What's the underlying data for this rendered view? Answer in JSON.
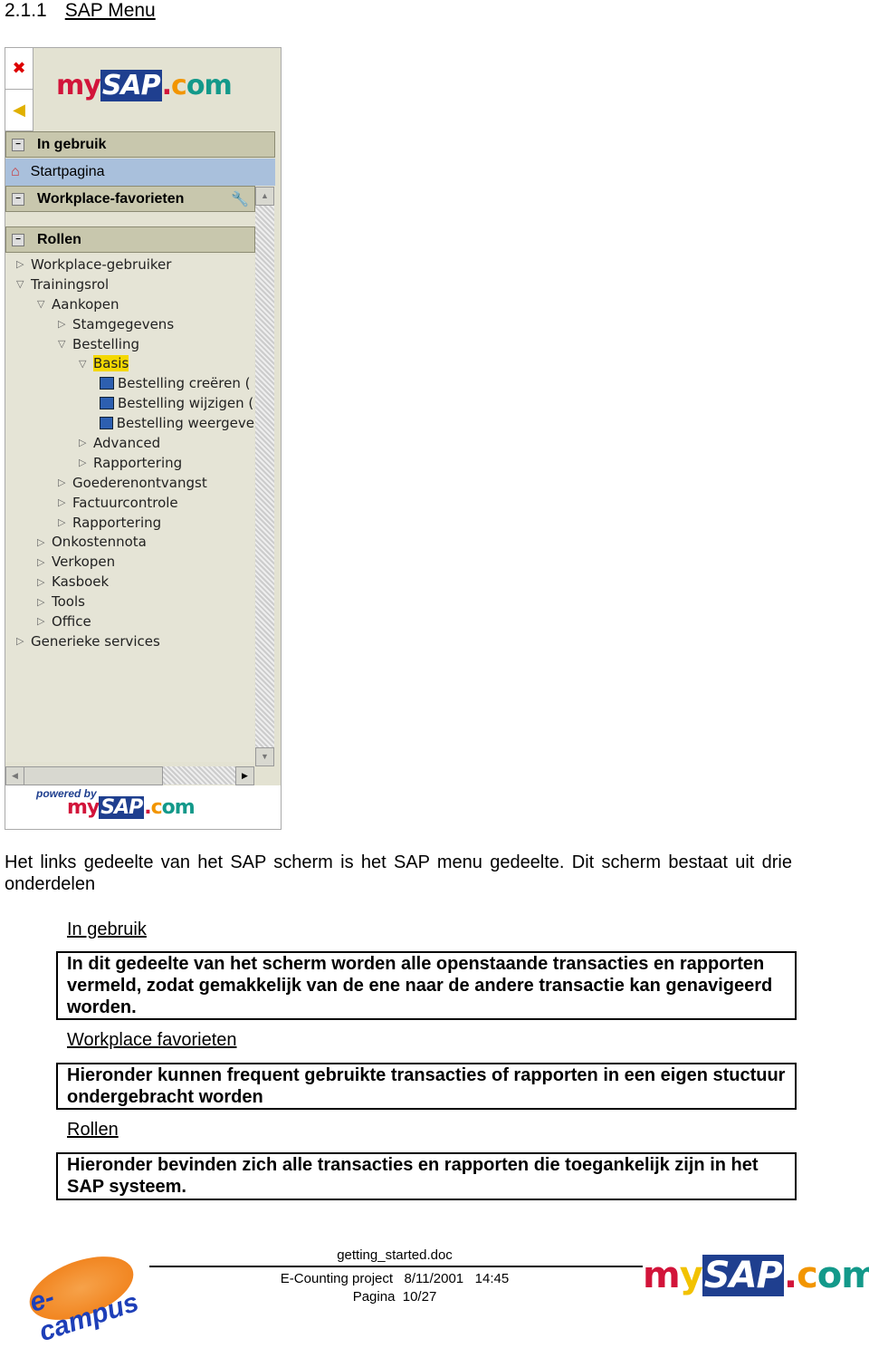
{
  "heading": {
    "number": "2.1.1",
    "title": "SAP Menu"
  },
  "panel": {
    "logo": {
      "my": "my",
      "sap": "SAP",
      "dot": ".",
      "com": "com"
    },
    "icons": {
      "close": "close-window-icon",
      "back": "back-arrow-icon"
    },
    "sections": {
      "in_use": "In gebruik",
      "favorites": "Workplace-favorieten",
      "roles": "Rollen"
    },
    "start_item": "Startpagina",
    "tree": [
      {
        "label": "Workplace-gebruiker",
        "level": 0,
        "type": "collapsed"
      },
      {
        "label": "Trainingsrol",
        "level": 0,
        "type": "expanded"
      },
      {
        "label": "Aankopen",
        "level": 1,
        "type": "expanded"
      },
      {
        "label": "Stamgegevens",
        "level": 2,
        "type": "collapsed"
      },
      {
        "label": "Bestelling",
        "level": 2,
        "type": "expanded"
      },
      {
        "label": "Basis",
        "level": 3,
        "type": "expanded",
        "selected": true
      },
      {
        "label": "Bestelling creëren (",
        "level": 4,
        "type": "transaction"
      },
      {
        "label": "Bestelling wijzigen (",
        "level": 4,
        "type": "transaction"
      },
      {
        "label": "Bestelling weergeve",
        "level": 4,
        "type": "transaction"
      },
      {
        "label": "Advanced",
        "level": 3,
        "type": "collapsed"
      },
      {
        "label": "Rapportering",
        "level": 3,
        "type": "collapsed"
      },
      {
        "label": "Goederenontvangst",
        "level": 2,
        "type": "collapsed"
      },
      {
        "label": "Factuurcontrole",
        "level": 2,
        "type": "collapsed"
      },
      {
        "label": "Rapportering",
        "level": 2,
        "type": "collapsed"
      },
      {
        "label": "Onkostennota",
        "level": 1,
        "type": "collapsed"
      },
      {
        "label": "Verkopen",
        "level": 1,
        "type": "collapsed"
      },
      {
        "label": "Kasboek",
        "level": 1,
        "type": "collapsed"
      },
      {
        "label": "Tools",
        "level": 1,
        "type": "collapsed"
      },
      {
        "label": "Office",
        "level": 1,
        "type": "collapsed"
      },
      {
        "label": "Generieke services",
        "level": 0,
        "type": "collapsed"
      }
    ],
    "powered_by": "powered by"
  },
  "intro": "Het links gedeelte van het SAP scherm is het SAP menu gedeelte. Dit scherm bestaat uit drie onderdelen",
  "parts": [
    {
      "title": "In gebruik",
      "text": "In dit gedeelte van het scherm worden alle openstaande transacties en rapporten vermeld, zodat gemakkelijk van de ene naar de andere transactie kan genavigeerd worden."
    },
    {
      "title": "Workplace favorieten",
      "text": "Hieronder kunnen frequent gebruikte transacties of rapporten in een eigen stuctuur ondergebracht worden"
    },
    {
      "title": "Rollen",
      "text": "Hieronder bevinden zich alle transacties en rapporten die toegankelijk zijn in het SAP systeem."
    }
  ],
  "footer": {
    "filename": "getting_started.doc",
    "project": "E-Counting project   8/11/2001   14:45",
    "page": "Pagina  10/27",
    "left_logo": "e-campus",
    "right_logo": "mySAP.com"
  },
  "colors": {
    "header": "#c8c7ad",
    "selected": "#f4d800",
    "start_row": "#a9c0dc",
    "sap_blue": "#1f3f8f"
  }
}
